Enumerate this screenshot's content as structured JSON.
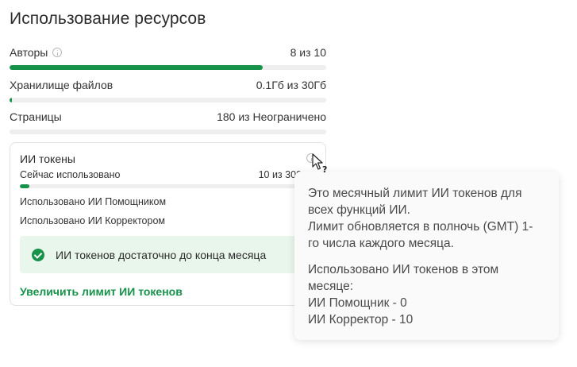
{
  "page": {
    "title": "Использование ресурсов"
  },
  "usage": [
    {
      "label": "Авторы",
      "value": "8 из 10",
      "has_info": true,
      "progress": 0.8
    },
    {
      "label": "Хранилище файлов",
      "value": "0.1Гб из 30Гб",
      "progress": 0.0033
    },
    {
      "label": "Страницы",
      "value": "180 из Неограничено",
      "progress": 0
    }
  ],
  "ai_tokens": {
    "title": "ИИ токены",
    "current_label": "Сейчас использовано",
    "current_value": "10 из 300",
    "progress": 0.033,
    "assistant_label": "Использовано ИИ Помощником",
    "corrector_label": "Использовано ИИ Корректором",
    "notice": "ИИ токенов достаточно до конца месяца",
    "link": "Увеличить лимит ИИ токенов"
  },
  "tooltip": {
    "line1": "Это месячный лимит ИИ токенов для",
    "line2": "всех функций ИИ.",
    "line3": "Лимит обновляется в полночь (GMT) 1-",
    "line4": "го числа каждого месяца.",
    "line5": "Использовано ИИ токенов в этом",
    "line6": "месяце:",
    "line7": "ИИ Помощник - 0",
    "line8": "ИИ Корректор - 10"
  },
  "colors": {
    "accent": "#17924a",
    "notice_bg": "#e9f6ec",
    "track": "#eeeeee"
  },
  "icons": {
    "info": "info-icon",
    "check": "check-circle-icon",
    "cursor": "pointer-help-cursor"
  }
}
